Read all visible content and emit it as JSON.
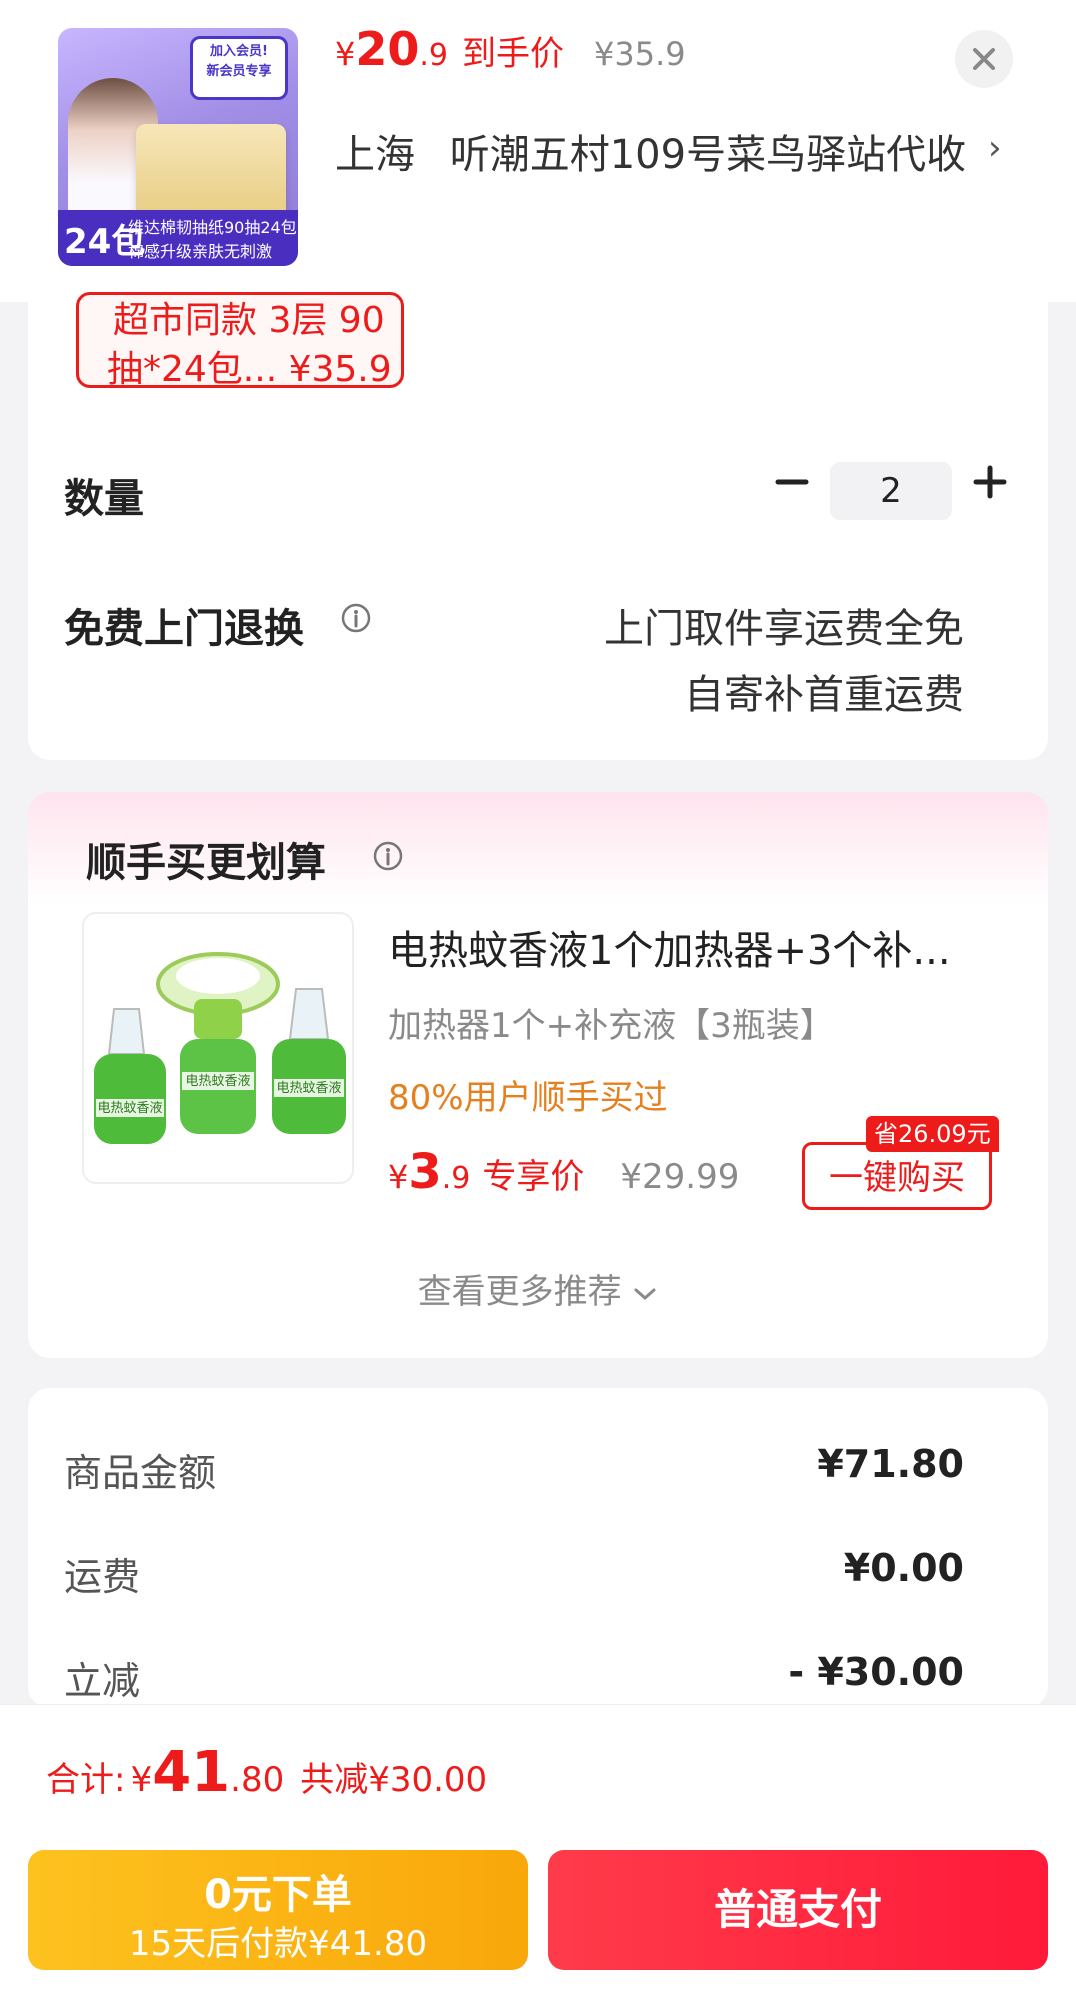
{
  "header": {
    "thumbnail": {
      "alt": "维达棉韧抽纸90抽24包",
      "badge_title": "加入会员!",
      "badge_sub": "新会员专享",
      "banner_count": "24包",
      "banner_text": "维达棉韧抽纸90抽24包",
      "banner_sub": "棉感升级亲肤无刺激"
    },
    "price_yen": "¥",
    "price_int": "20",
    "price_dec": ".9",
    "price_label": "到手价",
    "original_price": "¥35.9",
    "address_city": "上海",
    "address_detail": "听潮五村109号菜鸟驿站代收",
    "address_chevron": "›"
  },
  "spec": {
    "chip_line1": "超市同款 3层 90",
    "chip_line2": "抽*24包... ¥35.9"
  },
  "quantity": {
    "label": "数量",
    "value": "2"
  },
  "returns": {
    "label": "免费上门退换",
    "line1": "上门取件享运费全免",
    "line2": "自寄补首重运费"
  },
  "recommend": {
    "title": "顺手买更划算",
    "item": {
      "name": "电热蚊香液1个加热器+3个补...",
      "spec": "加热器1个+补充液【3瓶装】",
      "social": "80%用户顺手买过",
      "price_yen": "¥",
      "price_int": "3",
      "price_dec": ".9",
      "price_label": "专享价",
      "original_price": "¥29.99",
      "save_badge": "省26.09元",
      "buy_label": "一键购买",
      "bottle_label": "电热蚊香液"
    },
    "more_label": "查看更多推荐"
  },
  "summary": {
    "rows": [
      {
        "label": "商品金额",
        "value": "¥71.80"
      },
      {
        "label": "运费",
        "value": "¥0.00"
      },
      {
        "label": "立减",
        "value": "- ¥30.00"
      }
    ]
  },
  "footer": {
    "total_label": "合计:",
    "total_yen": "¥",
    "total_int": "41",
    "total_dec": ".80",
    "total_save": "共减¥30.00",
    "credit_line1": "0元下单",
    "credit_line2": "15天后付款¥41.80",
    "pay_label": "普通支付"
  },
  "colors": {
    "accent_red": "#ee1b1b",
    "orange": "#e5801e",
    "credit_yellow": "#fdc21f",
    "pay_red": "#ff1a3a"
  },
  "icons": [
    "close-icon",
    "chevron-right-icon",
    "minus-icon",
    "plus-icon",
    "info-icon",
    "chevron-down-icon"
  ]
}
